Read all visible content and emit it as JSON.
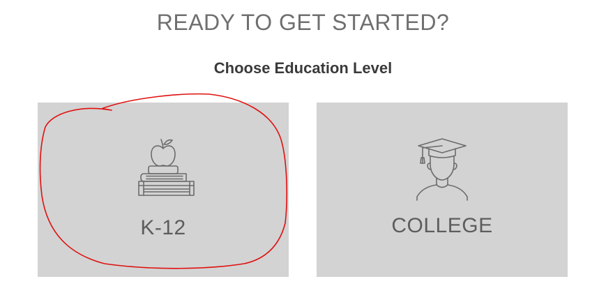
{
  "headline": "READY TO GET STARTED?",
  "subheading": "Choose Education Level",
  "options": [
    {
      "label": "K-12",
      "icon": "apple-on-books-icon"
    },
    {
      "label": "COLLEGE",
      "icon": "graduate-icon"
    }
  ],
  "colors": {
    "card_background": "#d3d3d3",
    "icon_stroke": "#6b6b6b",
    "label_text": "#5d5d5d",
    "annotation_stroke": "#e01010"
  }
}
